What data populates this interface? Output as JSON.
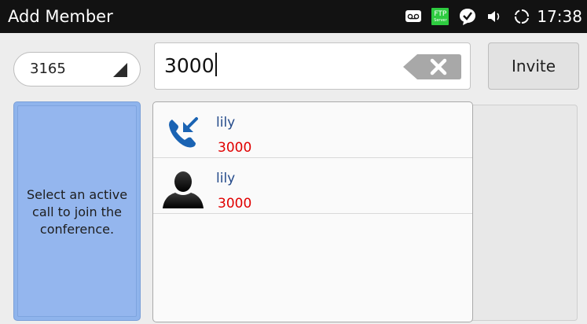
{
  "status_bar": {
    "title": "Add Member",
    "time": "17:38",
    "ftp_label": "FTP",
    "ftp_sub": "Server",
    "icons": [
      "voicemail-icon",
      "ftp-server-icon",
      "check-bubble-icon",
      "volume-icon",
      "sync-icon"
    ]
  },
  "account": {
    "value": "3165"
  },
  "search": {
    "value": "3000"
  },
  "invite_label": "Invite",
  "info_text": "Select an active call to join the conference.",
  "suggestions": [
    {
      "name": "lily",
      "number": "3000",
      "icon": "incoming-call-icon"
    },
    {
      "name": "lily",
      "number": "3000",
      "icon": "contact-avatar-icon"
    }
  ],
  "colors": {
    "status_bar_bg": "#121212",
    "panel_blue": "#8fb4ec",
    "name_blue": "#244a8a",
    "number_red": "#e00000",
    "ftp_green": "#2ecc40",
    "call_icon_blue": "#1a63b3"
  }
}
